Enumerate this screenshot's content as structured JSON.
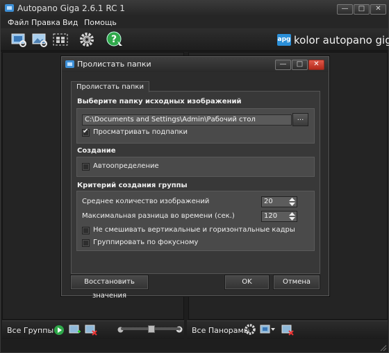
{
  "window": {
    "title": "Autopano Giga 2.6.1 RC 1"
  },
  "window_controls": {
    "minimize": "—",
    "maximize": "□",
    "close": "✕"
  },
  "menu": {
    "items": [
      "Файл",
      "Правка",
      "Вид",
      "Помощь"
    ]
  },
  "brand": {
    "logo": "apg",
    "text": "kolor autopano giga",
    "accent": "#2b8fd8"
  },
  "dialog": {
    "title": "Пролистать папки",
    "tab": "Пролистать папки",
    "source_section": {
      "title": "Выберите папку исходных изображений",
      "path": "C:\\Documents and Settings\\Admin\\Рабочий стол",
      "browse_label": "...",
      "subfolders_label": "Просматривать подпапки",
      "subfolders_checked": true
    },
    "creation_section": {
      "title": "Создание",
      "autodetect_label": "Автоопределение",
      "autodetect_checked": false
    },
    "group_section": {
      "title": "Критерий создания группы",
      "avg_images_label": "Среднее количество изображений",
      "avg_images_value": "20",
      "max_time_label": "Максимальная разница во времени (сек.)",
      "max_time_value": "120",
      "no_mix_label": "Не смешивать вертикальные и горизонтальные кадры",
      "no_mix_checked": false,
      "focus_label": "Группировать по фокусному",
      "focus_checked": false
    },
    "buttons": {
      "restore": "Восстановить значения",
      "ok": "OK",
      "cancel": "Отмена"
    }
  },
  "bottom_left": {
    "label": "Все Группы"
  },
  "bottom_right": {
    "label": "Все Панорамы"
  },
  "zoom_slider": {
    "level": 0.5
  }
}
